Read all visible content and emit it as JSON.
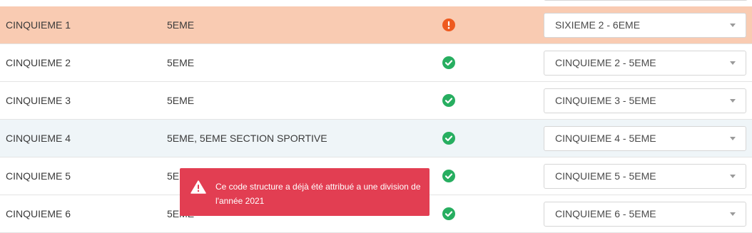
{
  "colors": {
    "error_row": "#f9cbb2",
    "alt_row": "#eff5f8",
    "ok": "#27ae60",
    "error_icon": "#ee5a1f",
    "toast": "#e23e52"
  },
  "rows": [
    {
      "name": "CINQUIEME 1",
      "level": "5EME",
      "status": "error",
      "status_icon": "exclamation-circle-icon",
      "select": "SIXIEME 2 - 6EME"
    },
    {
      "name": "CINQUIEME 2",
      "level": "5EME",
      "status": "ok",
      "status_icon": "check-circle-icon",
      "select": "CINQUIEME 2 - 5EME"
    },
    {
      "name": "CINQUIEME 3",
      "level": "5EME",
      "status": "ok",
      "status_icon": "check-circle-icon",
      "select": "CINQUIEME 3 - 5EME"
    },
    {
      "name": "CINQUIEME 4",
      "level": "5EME, 5EME SECTION SPORTIVE",
      "status": "ok",
      "status_icon": "check-circle-icon",
      "select": "CINQUIEME 4 - 5EME"
    },
    {
      "name": "CINQUIEME 5",
      "level": "5EME",
      "status": "ok",
      "status_icon": "check-circle-icon",
      "select": "CINQUIEME 5 - 5EME"
    },
    {
      "name": "CINQUIEME 6",
      "level": "5EME",
      "status": "ok",
      "status_icon": "check-circle-icon",
      "select": "CINQUIEME 6 - 5EME"
    }
  ],
  "toast": {
    "icon": "warning-triangle-icon",
    "message": "Ce code structure a déjà été attribué a une division de l'année 2021"
  }
}
